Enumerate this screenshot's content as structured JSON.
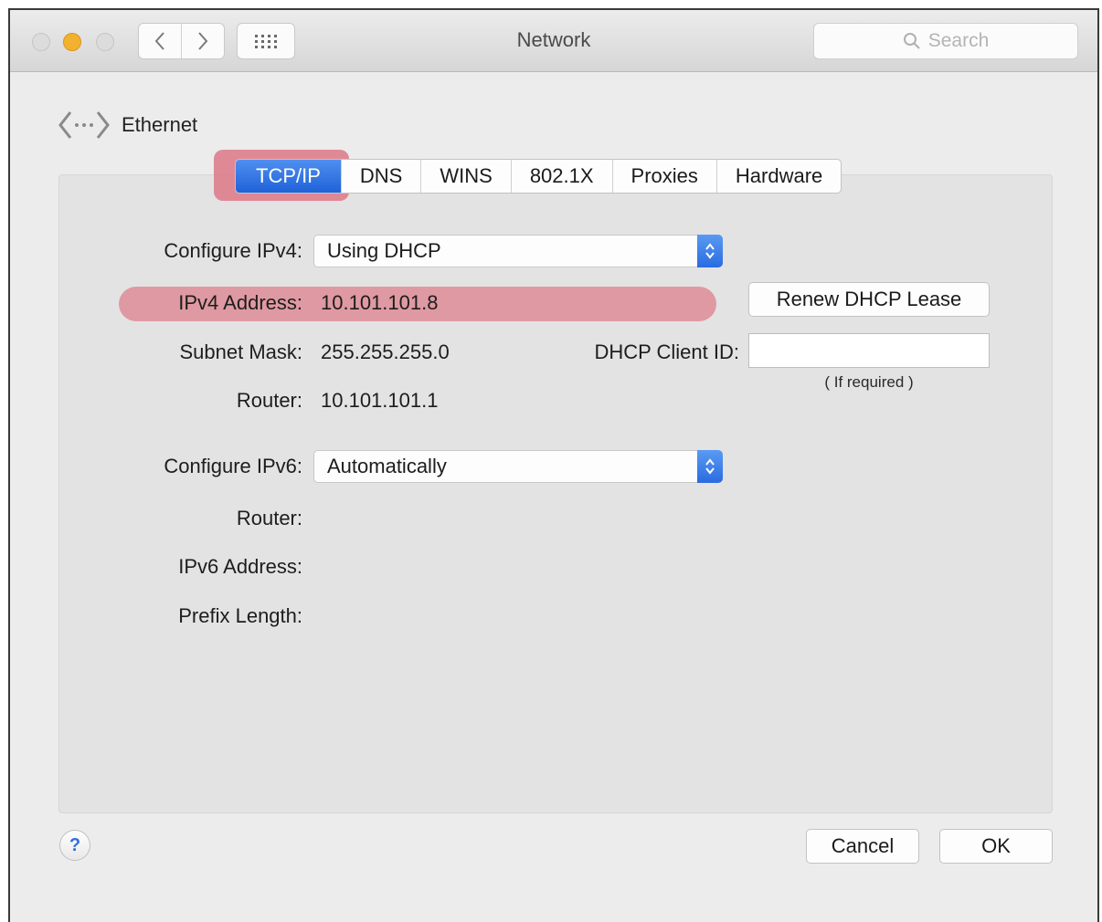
{
  "window": {
    "title": "Network"
  },
  "toolbar": {
    "search_placeholder": "Search"
  },
  "header": {
    "service_name": "Ethernet"
  },
  "tabs": [
    {
      "label": "TCP/IP",
      "active": true
    },
    {
      "label": "DNS"
    },
    {
      "label": "WINS"
    },
    {
      "label": "802.1X"
    },
    {
      "label": "Proxies"
    },
    {
      "label": "Hardware"
    }
  ],
  "ipv4": {
    "configure_label": "Configure IPv4:",
    "configure_value": "Using DHCP",
    "address_label": "IPv4 Address:",
    "address_value": "10.101.101.8",
    "subnet_label": "Subnet Mask:",
    "subnet_value": "255.255.255.0",
    "router_label": "Router:",
    "router_value": "10.101.101.1"
  },
  "dhcp": {
    "renew_label": "Renew DHCP Lease",
    "client_id_label": "DHCP Client ID:",
    "client_id_value": "",
    "client_id_hint": "( If required )"
  },
  "ipv6": {
    "configure_label": "Configure IPv6:",
    "configure_value": "Automatically",
    "router_label": "Router:",
    "address_label": "IPv6 Address:",
    "prefix_label": "Prefix Length:"
  },
  "footer": {
    "help_label": "?",
    "cancel_label": "Cancel",
    "ok_label": "OK"
  },
  "colors": {
    "accent": "#2a6ce0",
    "highlight": "#de8c96",
    "close": "#dcdcdc",
    "minimize": "#f2b12f"
  }
}
